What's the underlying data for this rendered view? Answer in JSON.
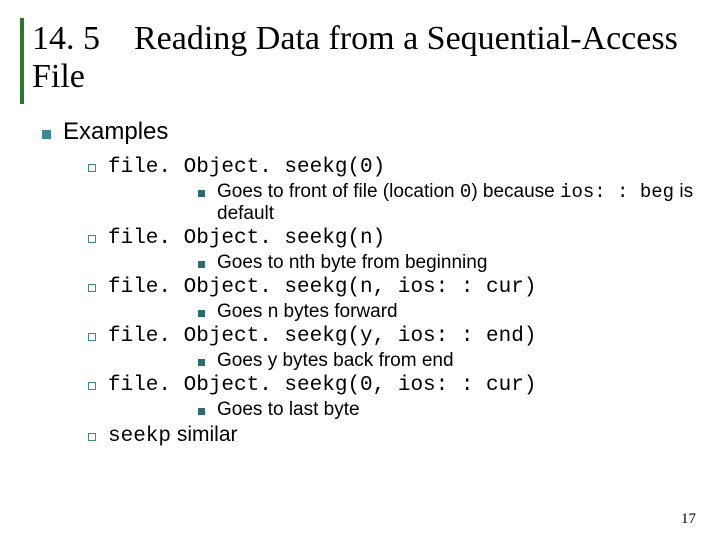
{
  "title": {
    "section_number": "14. 5",
    "text": "Reading Data from a Sequential-Access File"
  },
  "bullets": {
    "lvl1": "Examples",
    "items": [
      {
        "code": "file. Object. seekg(0)",
        "desc_pre": "Goes to front of file (location ",
        "desc_code1": "0",
        "desc_mid": ") because ",
        "desc_code2": "ios: : beg",
        "desc_post": " is default"
      },
      {
        "code": "file. Object. seekg(n)",
        "desc": "Goes to nth byte from beginning"
      },
      {
        "code": "file. Object. seekg(n, ios: : cur)",
        "desc": "Goes n bytes forward"
      },
      {
        "code": "file. Object. seekg(y, ios: : end)",
        "desc": "Goes y bytes back from end"
      },
      {
        "code": "file. Object. seekg(0, ios: : cur)",
        "desc": "Goes to last byte"
      },
      {
        "code_pre": "seekp",
        "plain": " similar"
      }
    ]
  },
  "page_number": "17"
}
